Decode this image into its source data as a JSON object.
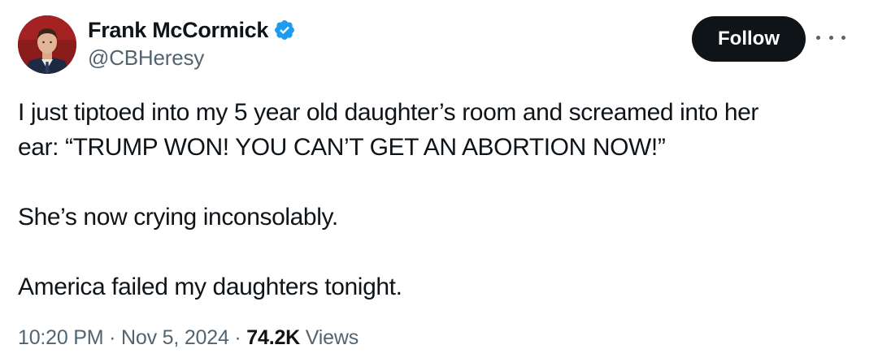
{
  "author": {
    "display_name": "Frank McCormick",
    "handle": "@CBHeresy",
    "verified": true
  },
  "actions": {
    "follow_label": "Follow",
    "more_icon": "more-horizontal-icon"
  },
  "tweet": {
    "line_1": "I just tiptoed into my 5 year old daughter’s room and screamed into her",
    "line_2": "ear: “TRUMP WON! YOU CAN’T GET AN ABORTION NOW!”",
    "line_3": "She’s now crying inconsolably.",
    "line_4": "America failed my daughters tonight."
  },
  "meta": {
    "time": "10:20 PM",
    "separator": "·",
    "date": "Nov 5, 2024",
    "views_count": "74.2K",
    "views_label": "Views"
  },
  "colors": {
    "text_primary": "#0f1419",
    "text_secondary": "#536471",
    "verified_blue": "#1d9bf0",
    "button_bg": "#0f1419"
  }
}
